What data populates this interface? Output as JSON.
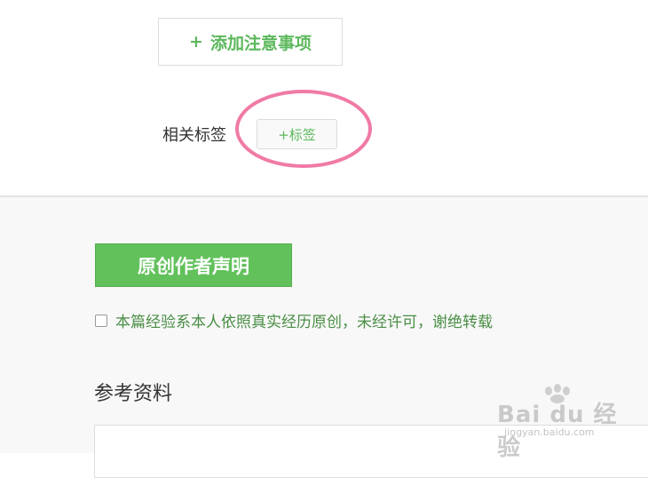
{
  "add_notes_button": {
    "plus": "+",
    "label": "添加注意事项"
  },
  "tags": {
    "label": "相关标签",
    "add_button": "+标签"
  },
  "declaration": {
    "title": "原创作者声明",
    "checkbox_checked": false,
    "text": "本篇经验系本人依照真实经历原创，未经许可，谢绝转载"
  },
  "references": {
    "title": "参考资料"
  },
  "watermark": {
    "main": "Bai du 经验",
    "sub": "jingyan.baidu.com",
    "icon": "paw-icon"
  },
  "colors": {
    "accent_green": "#5cb85c",
    "header_green": "#62c15b",
    "highlight_pink": "#f07aa6",
    "text_dark": "#333333"
  }
}
